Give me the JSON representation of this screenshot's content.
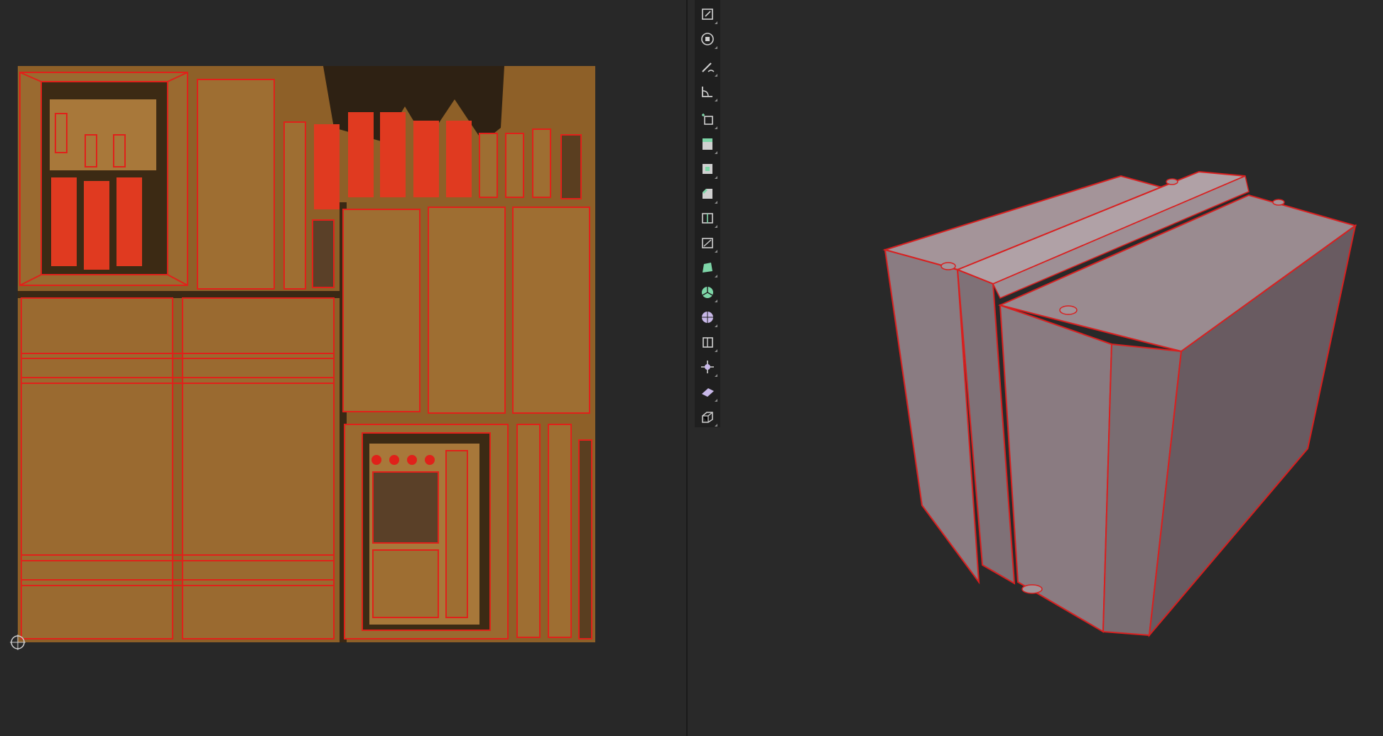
{
  "colors": {
    "background": "#282828",
    "uv_fill": "#9a6a30",
    "uv_edge": "#e0211a",
    "mesh_face": "#8f7e84",
    "mesh_edge": "#d82020",
    "toolbar_bg": "#1f1f1f",
    "icon_default": "#d0d0d0",
    "icon_add_green": "#7ed6a8",
    "icon_purple": "#c8b8e8"
  },
  "uv_editor": {
    "cursor_icon": "2d-cursor-icon"
  },
  "toolbar": {
    "tools": [
      {
        "name": "scale-cage-tool",
        "icon": "scale-cage-icon"
      },
      {
        "name": "transform-tool",
        "icon": "transform-icon"
      },
      {
        "name": "annotate-tool",
        "icon": "annotate-icon"
      },
      {
        "name": "measure-tool",
        "icon": "measure-icon"
      },
      {
        "name": "add-cube-tool",
        "icon": "add-cube-icon"
      },
      {
        "name": "extrude-region-tool",
        "icon": "extrude-region-icon"
      },
      {
        "name": "inset-faces-tool",
        "icon": "inset-faces-icon"
      },
      {
        "name": "bevel-tool",
        "icon": "bevel-icon"
      },
      {
        "name": "loop-cut-tool",
        "icon": "loop-cut-icon"
      },
      {
        "name": "knife-tool",
        "icon": "knife-icon"
      },
      {
        "name": "poly-build-tool",
        "icon": "poly-build-icon"
      },
      {
        "name": "spin-tool",
        "icon": "spin-icon"
      },
      {
        "name": "smooth-tool",
        "icon": "smooth-icon"
      },
      {
        "name": "edge-slide-tool",
        "icon": "edge-slide-icon"
      },
      {
        "name": "shrink-fatten-tool",
        "icon": "shrink-fatten-icon"
      },
      {
        "name": "shear-tool",
        "icon": "shear-icon"
      },
      {
        "name": "rip-region-tool",
        "icon": "rip-region-icon"
      }
    ]
  }
}
